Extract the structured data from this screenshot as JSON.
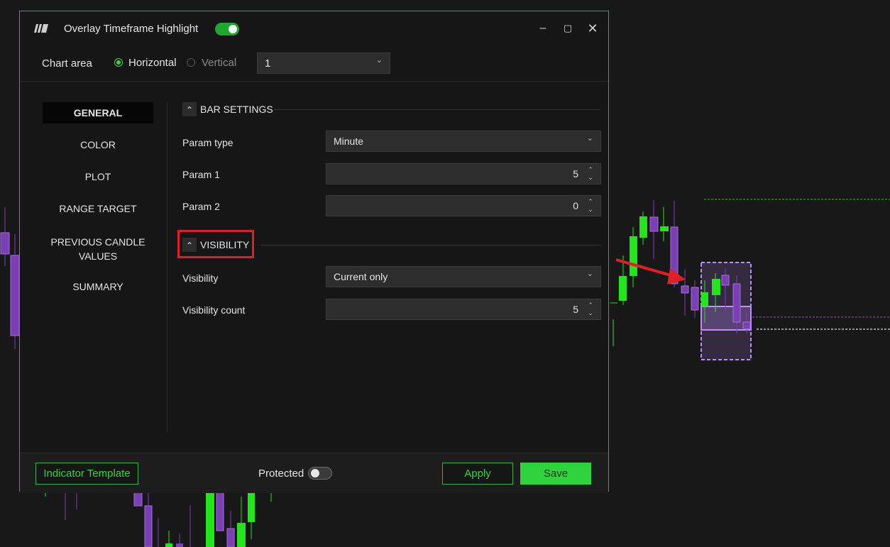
{
  "window": {
    "title": "Overlay Timeframe Highlight",
    "enabled": true,
    "minimize_icon": "minimize-icon",
    "maximize_icon": "maximize-icon",
    "close_icon": "close-icon"
  },
  "chart_area": {
    "label": "Chart area",
    "options": [
      "Horizontal",
      "Vertical"
    ],
    "selected": "Horizontal",
    "pane_value": "1"
  },
  "sidebar": {
    "items": [
      "GENERAL",
      "COLOR",
      "PLOT",
      "RANGE TARGET",
      "PREVIOUS CANDLE VALUES",
      "SUMMARY"
    ],
    "active": "GENERAL"
  },
  "bar_settings": {
    "title": "BAR SETTINGS",
    "param_type_label": "Param type",
    "param_type_value": "Minute",
    "param1_label": "Param 1",
    "param1_value": "5",
    "param2_label": "Param 2",
    "param2_value": "0"
  },
  "visibility": {
    "title": "VISIBILITY",
    "visibility_label": "Visibility",
    "visibility_value": "Current only",
    "count_label": "Visibility count",
    "count_value": "5"
  },
  "footer": {
    "template_label": "Indicator Template",
    "protected_label": "Protected",
    "protected": false,
    "apply_label": "Apply",
    "save_label": "Save"
  },
  "colors": {
    "accent_green": "#2ed33e",
    "bull_candle": "#22e61b",
    "bear_candle": "#7b3fb5",
    "highlight_red": "#e01e25",
    "overlay_purple": "#c08cff"
  }
}
